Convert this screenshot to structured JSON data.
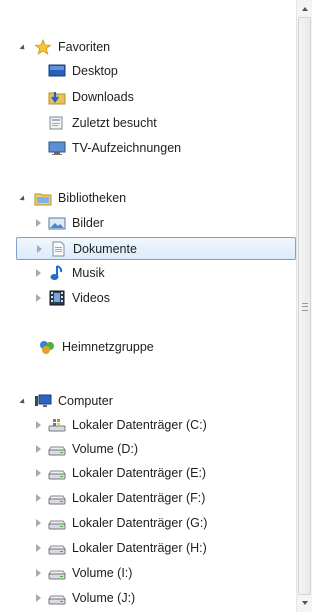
{
  "nav": {
    "favorites": {
      "label": "Favoriten",
      "items": [
        {
          "label": "Desktop",
          "icon": "desktop-icon"
        },
        {
          "label": "Downloads",
          "icon": "downloads-icon"
        },
        {
          "label": "Zuletzt besucht",
          "icon": "recent-places-icon"
        },
        {
          "label": "TV-Aufzeichnungen",
          "icon": "tv-recordings-icon"
        }
      ]
    },
    "libraries": {
      "label": "Bibliotheken",
      "items": [
        {
          "label": "Bilder",
          "icon": "pictures-icon"
        },
        {
          "label": "Dokumente",
          "icon": "documents-icon",
          "selected": true
        },
        {
          "label": "Musik",
          "icon": "music-icon"
        },
        {
          "label": "Videos",
          "icon": "videos-icon"
        }
      ]
    },
    "homegroup": {
      "label": "Heimnetzgruppe"
    },
    "computer": {
      "label": "Computer",
      "items": [
        {
          "label": "Lokaler Datenträger (C:)",
          "icon": "system-drive-icon"
        },
        {
          "label": "Volume (D:)",
          "icon": "drive-icon"
        },
        {
          "label": "Lokaler Datenträger (E:)",
          "icon": "drive-icon"
        },
        {
          "label": "Lokaler Datenträger (F:)",
          "icon": "drive-icon"
        },
        {
          "label": "Lokaler Datenträger (G:)",
          "icon": "drive-icon"
        },
        {
          "label": "Lokaler Datenträger (H:)",
          "icon": "drive-icon"
        },
        {
          "label": "Volume (I:)",
          "icon": "drive-icon"
        },
        {
          "label": "Volume (J:)",
          "icon": "drive-icon"
        }
      ]
    }
  },
  "colors": {
    "selection_border": "#7da2ce",
    "selection_fill": "#dcebfc"
  }
}
